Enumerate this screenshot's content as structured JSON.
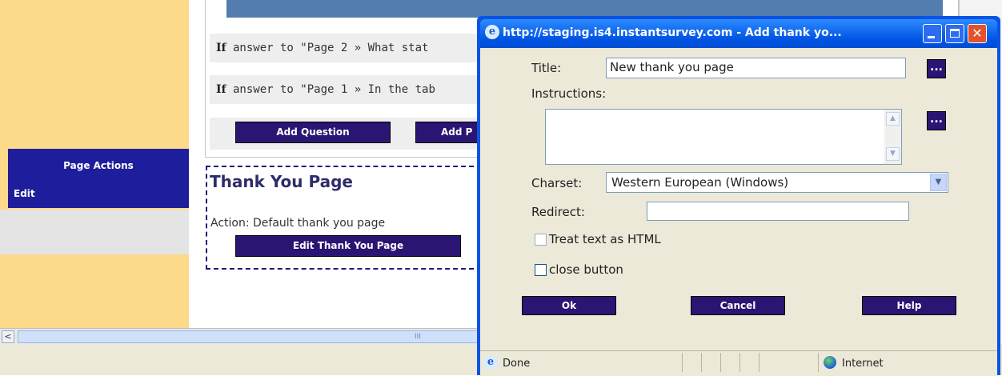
{
  "background": {
    "sidebar": {
      "page_actions_title": "Page Actions",
      "edit_label": "Edit"
    },
    "conditions": [
      {
        "keyword": "If",
        "text": " answer to \"Page 2 » What stat"
      },
      {
        "keyword": "If",
        "text": " answer to \"Page 1 » In the tab"
      }
    ],
    "buttons": {
      "add_question": "Add Question",
      "add_page": "Add P"
    },
    "thank_you": {
      "title": "Thank You Page",
      "action": "Action: Default thank you page",
      "edit_button": "Edit Thank You Page"
    },
    "scroll_left": "<",
    "scroll_thumb_grip": "III"
  },
  "popup": {
    "window_title": "http://staging.is4.instantsurvey.com - Add thank yo...",
    "title_label": "Title:",
    "title_value": "New thank you page",
    "instructions_label": "Instructions:",
    "instructions_value": "",
    "dots_label": "...",
    "charset_label": "Charset:",
    "charset_value": "Western European (Windows)",
    "redirect_label": "Redirect:",
    "redirect_value": "",
    "treat_html_label": "Treat text as HTML",
    "treat_html_checked": false,
    "close_button_label": "close button",
    "close_button_checked": false,
    "ok_label": "Ok",
    "cancel_label": "Cancel",
    "help_label": "Help",
    "status_done": "Done",
    "status_zone": "Internet",
    "close_glyph": "✕"
  },
  "colors": {
    "navy_button": "#2a1573",
    "sidebar_blue": "#1e1e9c",
    "sidebar_yellow": "#fdd98a",
    "xp_title_blue": "#0054e3",
    "dialog_bg": "#ece9d8"
  }
}
